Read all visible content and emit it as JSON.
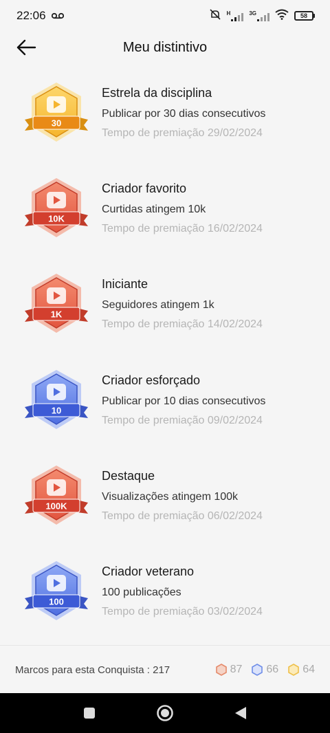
{
  "status_bar": {
    "time": "22:06",
    "battery": "58",
    "network_labels": [
      "H",
      "3G"
    ]
  },
  "header": {
    "title": "Meu distintivo"
  },
  "badges": [
    {
      "name": "Estrela da disciplina",
      "description": "Publicar por 30 dias consecutivos",
      "time": "Tempo de premiação 29/02/2024",
      "medal_label": "30",
      "tier": "gold"
    },
    {
      "name": "Criador favorito",
      "description": "Curtidas atingem 10k",
      "time": "Tempo de premiação 16/02/2024",
      "medal_label": "10K",
      "tier": "red"
    },
    {
      "name": "Iniciante",
      "description": "Seguidores atingem 1k",
      "time": "Tempo de premiação 14/02/2024",
      "medal_label": "1K",
      "tier": "red"
    },
    {
      "name": "Criador esforçado",
      "description": "Publicar por 10 dias consecutivos",
      "time": "Tempo de premiação 09/02/2024",
      "medal_label": "10",
      "tier": "blue"
    },
    {
      "name": "Destaque",
      "description": "Visualizações atingem 100k",
      "time": "Tempo de premiação 06/02/2024",
      "medal_label": "100K",
      "tier": "red"
    },
    {
      "name": "Criador veterano",
      "description": "100 publicações",
      "time": "Tempo de premiação 03/02/2024",
      "medal_label": "100",
      "tier": "blue"
    }
  ],
  "footer": {
    "label": "Marcos para esta Conquista : 217",
    "counts": {
      "red": "87",
      "blue": "66",
      "gold": "64"
    }
  },
  "colors": {
    "gold": "#f5b52e",
    "red": "#e2553f",
    "blue": "#4f6fe0",
    "muted_text": "#b5b5b5"
  }
}
